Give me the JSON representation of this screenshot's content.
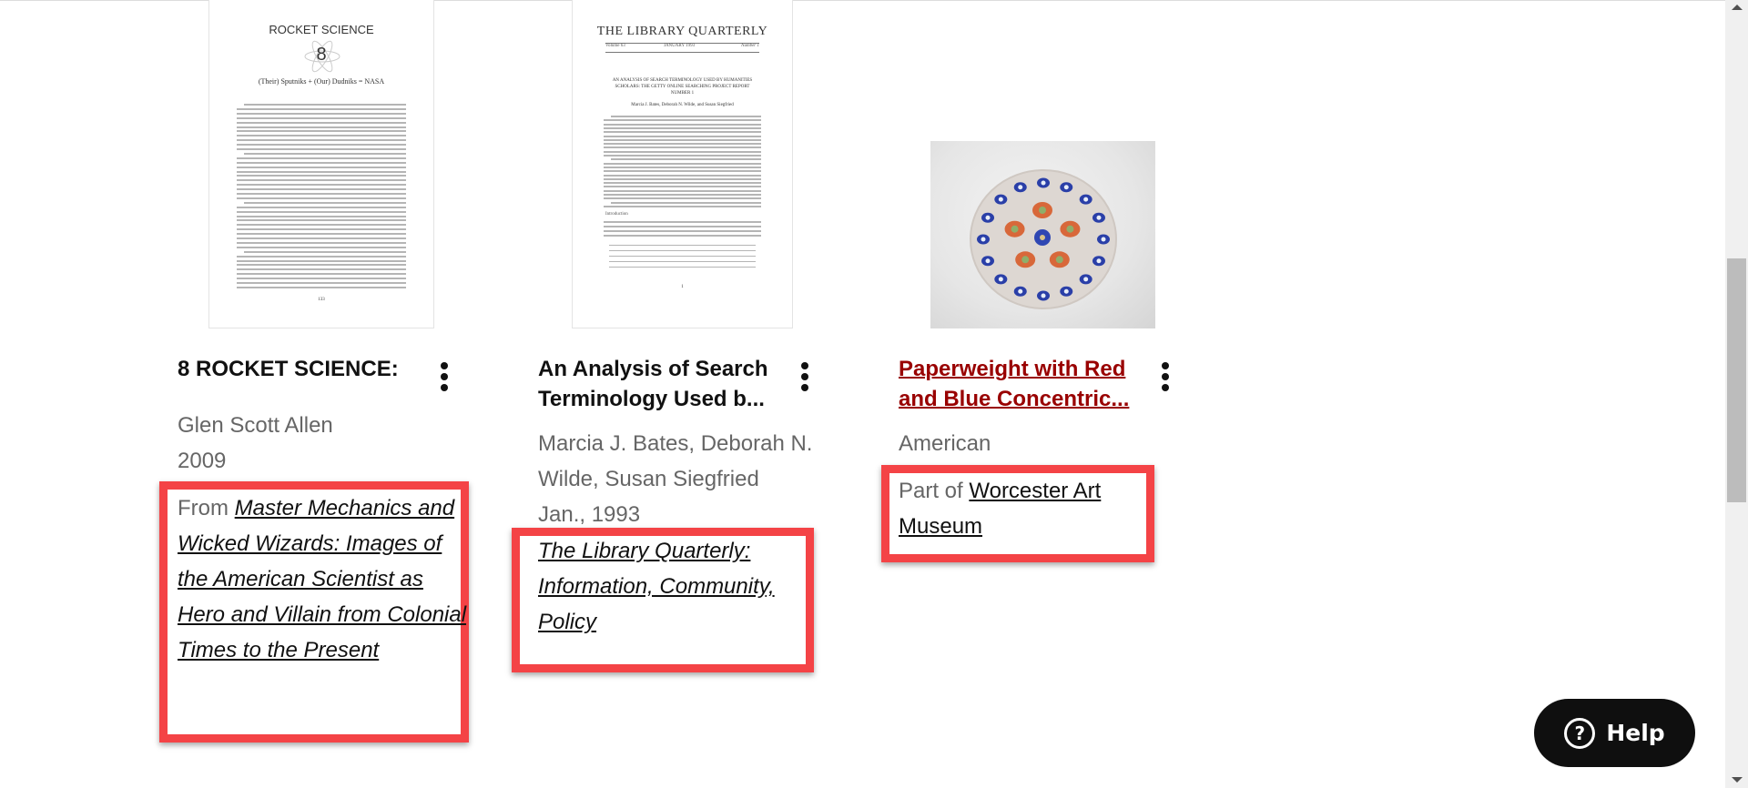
{
  "results": [
    {
      "thumbnail": {
        "kind": "page-scan",
        "heading": "ROCKET SCIENCE",
        "chapter_number": "8",
        "subheading": "(Their) Sputniks + (Our) Dudniks = NASA",
        "page_number": "133"
      },
      "title": "8 ROCKET SCIENCE:",
      "title_is_link": false,
      "meta_lines": [
        "Glen Scott Allen",
        "2009"
      ],
      "source_prefix": "From ",
      "source_link": "Master Mechanics and Wicked Wizards: Images of the American Scientist as Hero and Villain from Colonial Times to the Present",
      "source_italic": true,
      "menu_icon": "more-vertical-icon"
    },
    {
      "thumbnail": {
        "kind": "page-scan",
        "heading": "THE LIBRARY QUARTERLY",
        "volume": "Volume 63",
        "issue_date": "JANUARY 1993",
        "number": "Number 1",
        "article_title": "AN ANALYSIS OF SEARCH TERMINOLOGY USED BY HUMANITIES SCHOLARS: THE GETTY ONLINE SEARCHING PROJECT REPORT NUMBER 1",
        "authors": "Marcia J. Bates, Deborah N. Wilde, and Susan Siegfried",
        "section": "Introduction",
        "page_number": "1"
      },
      "title": "An Analysis of Search Terminology Used b...",
      "title_is_link": false,
      "meta_lines": [
        "Marcia J. Bates, Deborah N.",
        "Wilde, Susan Siegfried",
        "Jan., 1993"
      ],
      "source_prefix": "",
      "source_link": "The Library Quarterly: Information, Community, Policy",
      "source_italic": true,
      "menu_icon": "more-vertical-icon"
    },
    {
      "thumbnail": {
        "kind": "photo",
        "subject": "glass paperweight with red and blue canes"
      },
      "title": "Paperweight with Red and Blue Concentric...",
      "title_is_link": true,
      "meta_lines": [
        "American"
      ],
      "source_prefix": "Part of ",
      "source_link": "Worcester Art Museum",
      "source_italic": false,
      "menu_icon": "more-vertical-icon"
    }
  ],
  "help_button": {
    "label": "Help",
    "icon": "question-circle-icon"
  },
  "colors": {
    "title_link": "#990000",
    "highlight_box": "#f44346",
    "meta_text": "#666666",
    "help_bg": "#0f0f0f"
  }
}
